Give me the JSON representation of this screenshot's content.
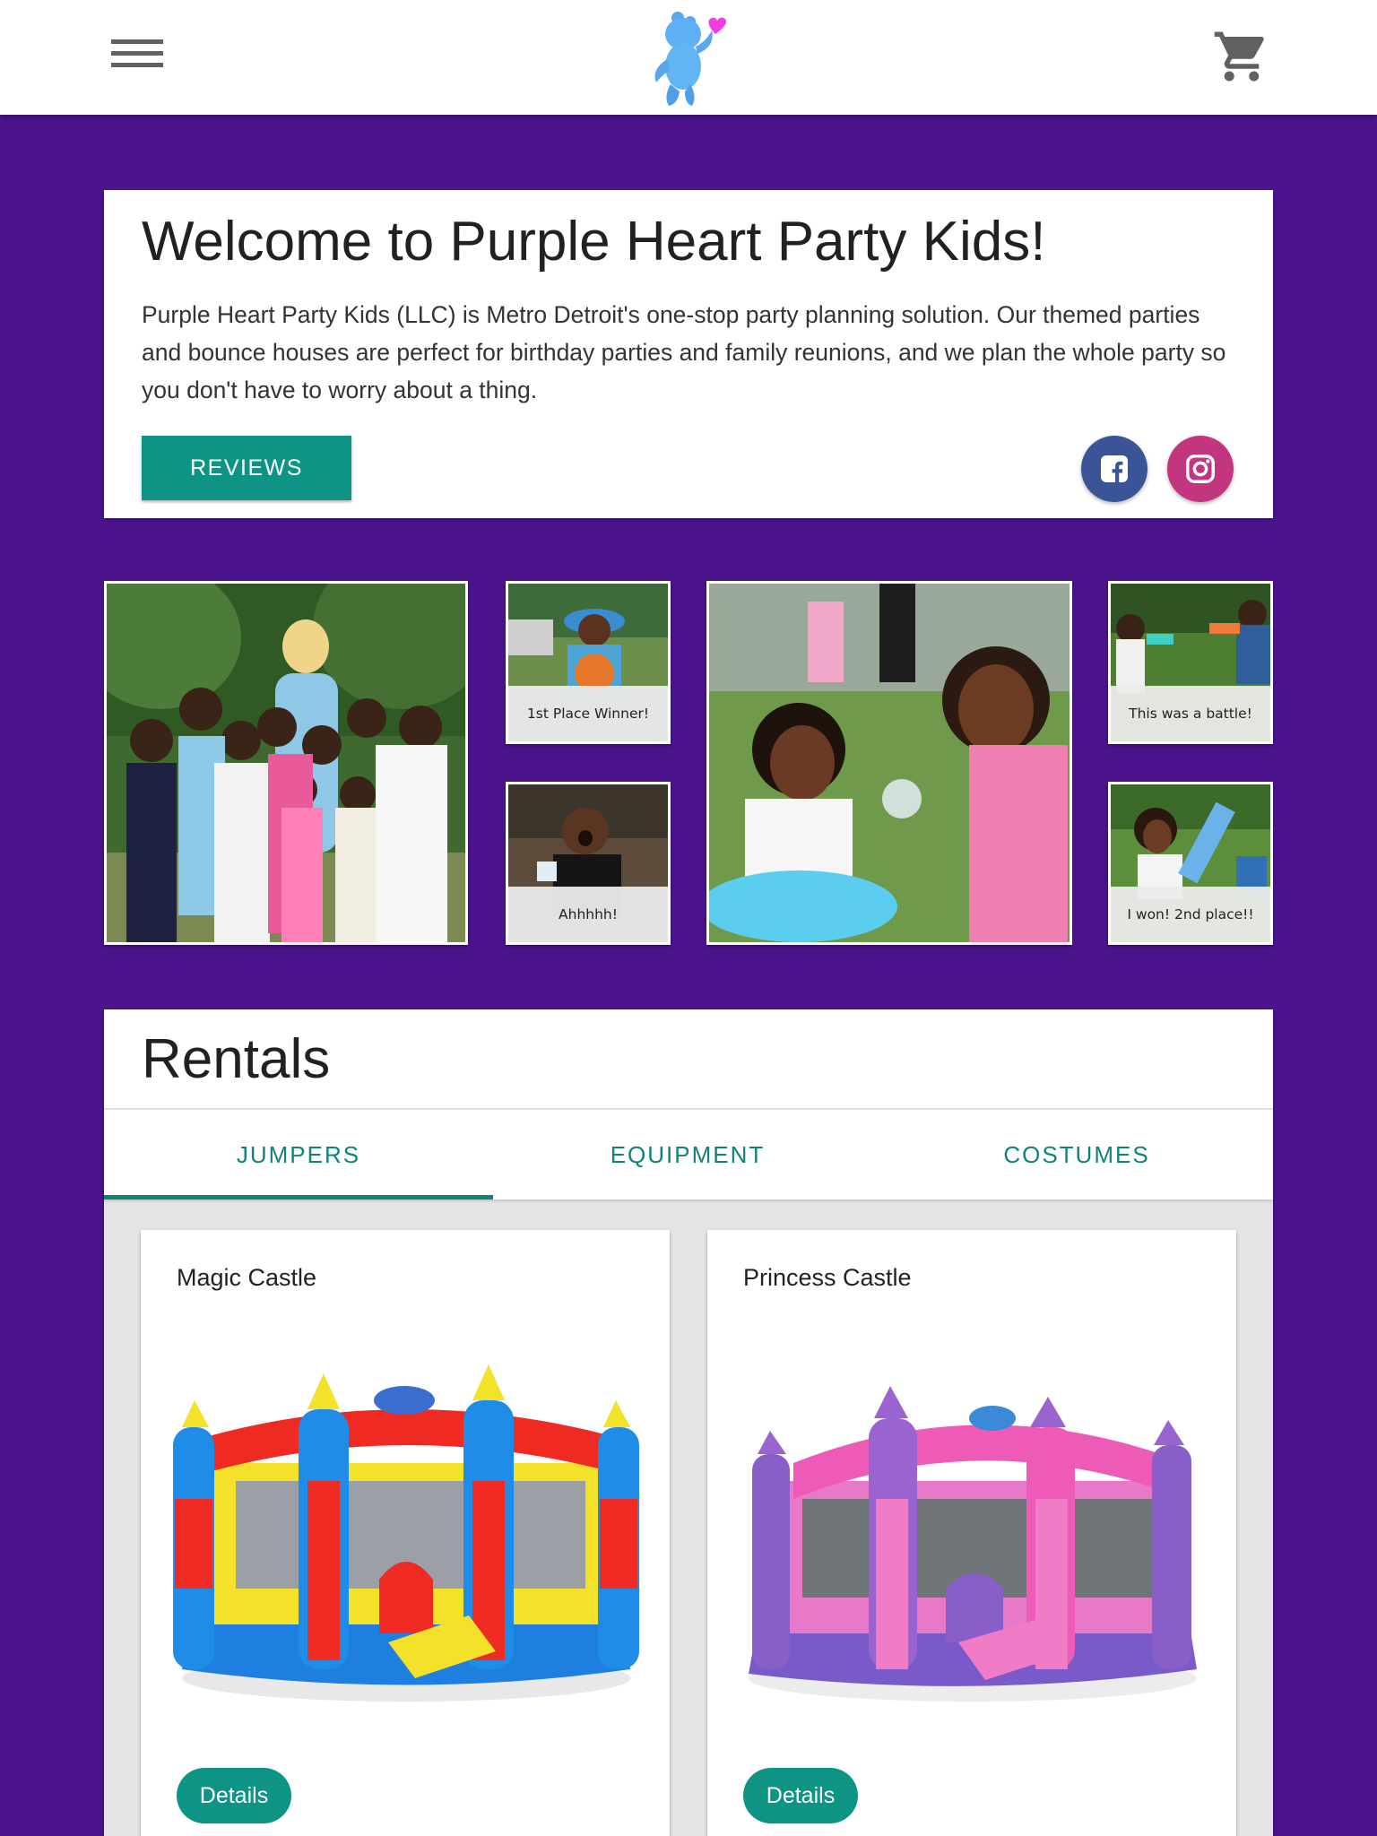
{
  "header": {
    "menu_icon": "hamburger-menu-icon",
    "logo": "purple-bear-heart-logo",
    "cart_icon": "shopping-cart-icon"
  },
  "welcome": {
    "title": "Welcome to Purple Heart Party Kids!",
    "description": "Purple Heart Party Kids (LLC) is Metro Detroit's one-stop party planning solution. Our themed parties and bounce houses are perfect for birthday parties and family reunions, and we plan the whole party so you don't have to worry about a thing.",
    "reviews_label": "REVIEWS",
    "social": [
      {
        "icon": "facebook-icon",
        "color": "#3b5397"
      },
      {
        "icon": "instagram-icon",
        "color": "#c2357f"
      }
    ]
  },
  "gallery": {
    "captions": [
      "1st Place Winner!",
      "Ahhhhh!",
      "This was a battle!",
      "I won! 2nd place!!"
    ]
  },
  "rentals": {
    "title": "Rentals",
    "tabs": [
      "JUMPERS",
      "EQUIPMENT",
      "COSTUMES"
    ],
    "active_tab": "JUMPERS",
    "items": [
      {
        "name": "Magic Castle",
        "button": "Details"
      },
      {
        "name": "Princess Castle",
        "button": "Details"
      }
    ]
  },
  "colors": {
    "background": "#4b148d",
    "accent": "#0e9484",
    "tab_text": "#0e8478"
  }
}
